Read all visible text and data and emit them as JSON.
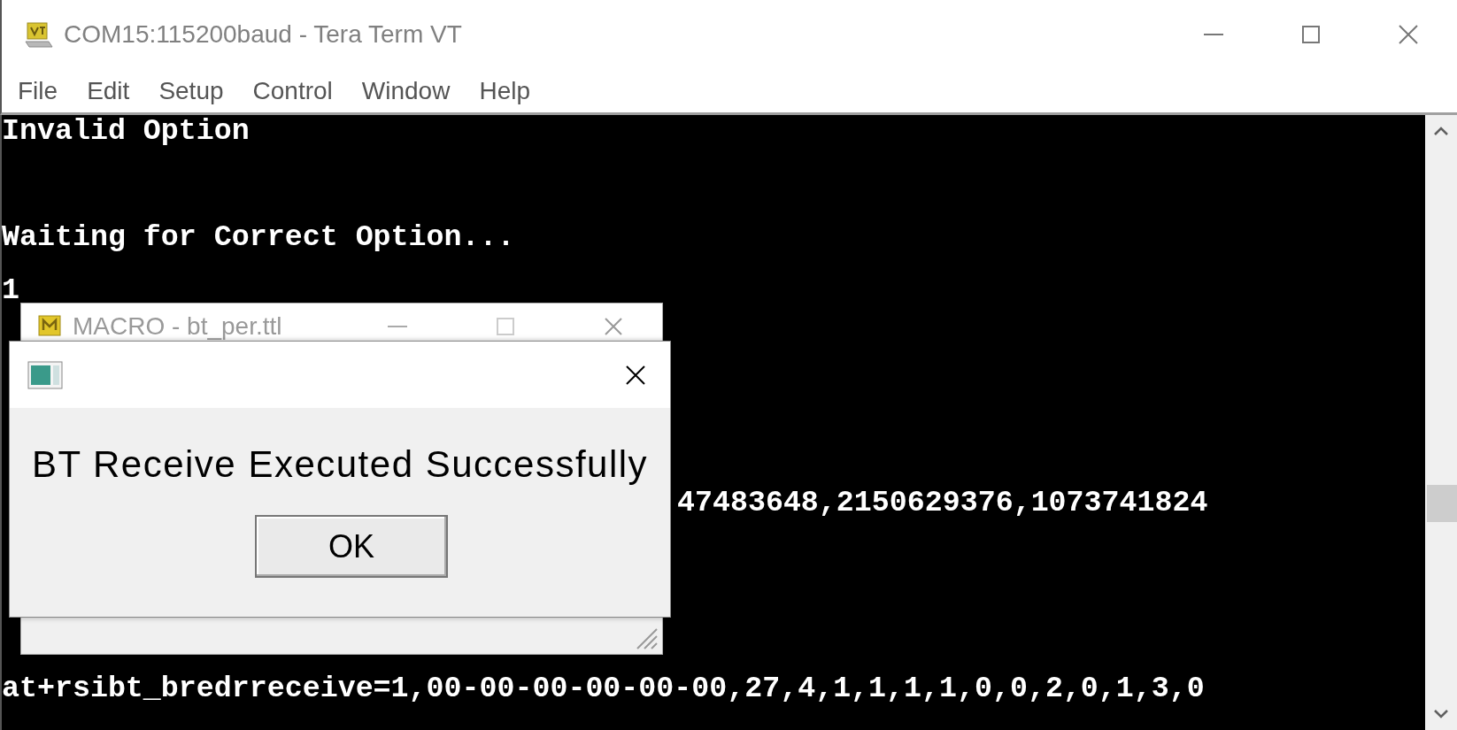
{
  "window": {
    "title": "COM15:115200baud - Tera Term VT"
  },
  "menu": [
    "File",
    "Edit",
    "Setup",
    "Control",
    "Window",
    "Help"
  ],
  "terminal": {
    "lines": [
      {
        "kind": "text",
        "text": "Invalid Option"
      },
      {
        "kind": "blank"
      },
      {
        "kind": "blank"
      },
      {
        "kind": "blank"
      },
      {
        "kind": "text",
        "text": "Waiting for Correct Option..."
      },
      {
        "kind": "blank"
      },
      {
        "kind": "text",
        "text": "1"
      },
      {
        "kind": "blank"
      },
      {
        "kind": "blank"
      },
      {
        "kind": "blank"
      },
      {
        "kind": "blank"
      },
      {
        "kind": "blank"
      },
      {
        "kind": "blank"
      },
      {
        "kind": "blank"
      },
      {
        "kind": "partial",
        "text": "47483648,2150629376,1073741824"
      },
      {
        "kind": "blank"
      },
      {
        "kind": "blank"
      },
      {
        "kind": "blank"
      },
      {
        "kind": "blank"
      },
      {
        "kind": "blank"
      },
      {
        "kind": "blank"
      },
      {
        "kind": "text",
        "text": "at+rsibt_bredrreceive=1,00-00-00-00-00-00,27,4,1,1,1,1,0,0,2,0,1,3,0"
      }
    ]
  },
  "macro_window": {
    "title": "MACRO - bt_per.ttl"
  },
  "message_box": {
    "message": "BT Receive Executed Successfully",
    "buttons": [
      "OK"
    ]
  }
}
